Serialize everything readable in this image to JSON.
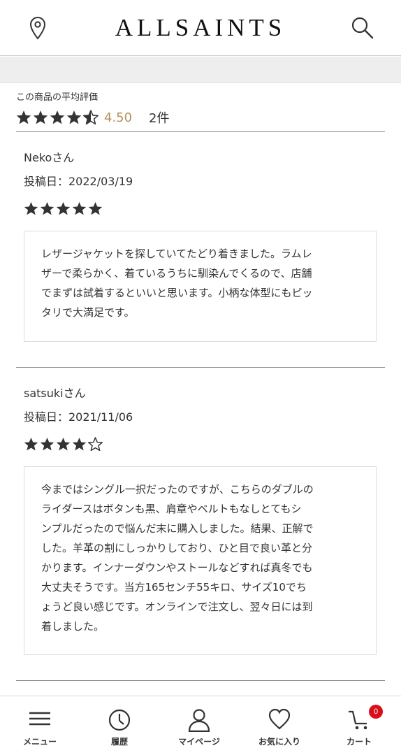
{
  "header": {
    "logo": "ALLSAINTS",
    "location_icon": "map-pin-icon",
    "search_icon": "search-icon"
  },
  "summary": {
    "title": "この商品の平均評価",
    "rating_stars": 4.5,
    "average": "4.50",
    "count": "2件"
  },
  "reviews": [
    {
      "user": "Nekoさん",
      "date": "投稿日：2022/03/19",
      "stars": 5,
      "lines": [
        "レザージャケットを探していてたどり着きました。ラムレ",
        "ザーで柔らかく、着ているうちに馴染んでくるので、店舗",
        "でまずは試着するといいと思います。小柄な体型にもピッ",
        "タリで大満足です。"
      ]
    },
    {
      "user": "satsukiさん",
      "date": "投稿日：2021/11/06",
      "stars": 4,
      "lines": [
        "今まではシングル一択だったのですが、こちらのダブルの",
        "ライダースはボタンも黒、肩章やベルトもなしとてもシ",
        "ンプルだったので悩んだ末に購入しました。結果、正解で",
        "した。羊革の割にしっかりしており、ひと目で良い革と分",
        "かります。インナーダウンやストールなどすれば真冬でも",
        "大丈夫そうです。当方165センチ55キロ、サイズ10でち",
        "ょうど良い感じです。オンラインで注文し、翌々日には到",
        "着しました。"
      ]
    }
  ],
  "tabbar": {
    "menu": "メニュー",
    "history": "履歴",
    "mypage": "マイページ",
    "favorites": "お気に入り",
    "cart": "カート",
    "cart_badge": "0"
  },
  "colors": {
    "accent_gold": "#b39256",
    "star": "#333333",
    "badge": "#d8101c"
  }
}
